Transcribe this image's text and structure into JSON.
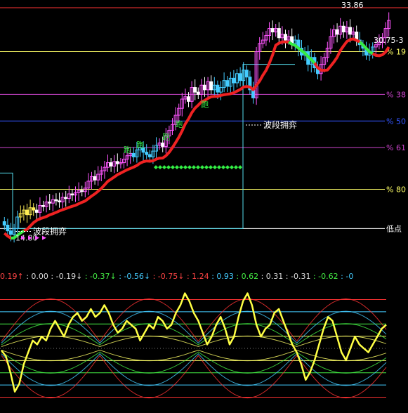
{
  "chart_data": [
    {
      "type": "candlestick",
      "panel": "price",
      "ylim": [
        13.5,
        35.0
      ],
      "price_labels": [
        {
          "text": "33.86",
          "value": 34.95
        },
        {
          "text": "30.75-3",
          "value": 31.9
        },
        {
          "text": "14.80",
          "value": 14.8
        }
      ],
      "fib_levels": [
        {
          "text": "% 19",
          "value": 30.9,
          "color": "#ffff66"
        },
        {
          "text": "% 38",
          "value": 27.2,
          "color": "#cc44cc"
        },
        {
          "text": "% 50",
          "value": 24.9,
          "color": "#3355ff"
        },
        {
          "text": "% 61",
          "value": 22.6,
          "color": "#cc44cc"
        },
        {
          "text": "% 80",
          "value": 19.0,
          "color": "#ffff66"
        },
        {
          "text": "低点",
          "value": 15.6,
          "color": "#ffffff"
        }
      ],
      "top_line": {
        "value": 34.7,
        "color": "#ff3333"
      },
      "annotations": [
        {
          "text": "波段拥弈",
          "value": 15.35,
          "color": "#ffffff"
        },
        {
          "text": "波段拥弈",
          "value": 24.55,
          "color": "#ffffff"
        }
      ],
      "marks": [
        "跑",
        "跑",
        "跑",
        "跑",
        "跑"
      ],
      "close": [
        15.9,
        15.4,
        15.1,
        15.6,
        16.6,
        16.9,
        17.2,
        16.8,
        17.4,
        17.2,
        17.0,
        17.6,
        17.5,
        17.9,
        17.8,
        18.1,
        18.0,
        17.9,
        18.3,
        18.2,
        18.6,
        18.5,
        18.7,
        18.9,
        18.8,
        19.1,
        19.7,
        20.1,
        19.8,
        20.3,
        20.6,
        20.9,
        21.3,
        21.0,
        21.4,
        21.2,
        21.3,
        21.6,
        21.9,
        22.1,
        21.8,
        22.4,
        22.6,
        22.2,
        22.0,
        21.8,
        22.3,
        22.8,
        23.0,
        22.7,
        23.6,
        24.1,
        24.6,
        25.4,
        26.0,
        26.8,
        27.0,
        26.6,
        27.8,
        27.4,
        27.2,
        28.0,
        27.6,
        28.3,
        27.6,
        28.0,
        27.4,
        27.8,
        28.4,
        27.9,
        28.6,
        28.2,
        29.0,
        28.4,
        29.3,
        28.7,
        27.6,
        26.9,
        30.9,
        31.6,
        31.9,
        32.3,
        32.9,
        32.6,
        32.9,
        32.1,
        32.4,
        31.9,
        32.2,
        31.6,
        31.9,
        31.2,
        30.6,
        30.9,
        29.8,
        30.4,
        29.5,
        29.0,
        29.8,
        30.4,
        31.2,
        32.2,
        32.8,
        32.4,
        33.1,
        32.6,
        33.0,
        32.4,
        32.6,
        31.9,
        31.5,
        31.2,
        30.6,
        30.9,
        31.3,
        31.5,
        31.7,
        32.1,
        32.9,
        33.6
      ]
    },
    {
      "type": "line",
      "panel": "oscillator",
      "ylim": [
        -1.5,
        1.5
      ],
      "values_bar": [
        {
          "text": "0.19↑",
          "color": "#ff4444"
        },
        {
          "text": ": 0.00",
          "color": "#dddddd"
        },
        {
          "text": ": -0.19↓",
          "color": "#dddddd"
        },
        {
          "text": ": -0.37↓",
          "color": "#44ee44"
        },
        {
          "text": ": -0.56↓",
          "color": "#44ccff"
        },
        {
          "text": ": -0.75↓",
          "color": "#ff4444"
        },
        {
          "text": ": 1.24",
          "color": "#ff4444"
        },
        {
          "text": ": 0.93",
          "color": "#44ccff"
        },
        {
          "text": ": 0.62",
          "color": "#44ee44"
        },
        {
          "text": ": 0.31",
          "color": "#dddddd"
        },
        {
          "text": ": -0.31",
          "color": "#dddddd"
        },
        {
          "text": ": -0.62",
          "color": "#44ee44"
        },
        {
          "text": ": -0",
          "color": "#44ccff"
        }
      ],
      "levels": [
        1.24,
        0.93,
        0.62,
        0.31,
        0.0,
        -0.31,
        -0.62,
        -0.93,
        -1.24
      ],
      "series": [
        {
          "color": "#ffff44",
          "values": [
            -0.05,
            -0.2,
            -0.6,
            -1.1,
            -0.9,
            -0.4,
            -0.1,
            0.2,
            0.1,
            0.3,
            0.2,
            0.5,
            0.7,
            0.5,
            0.3,
            0.6,
            0.8,
            0.9,
            0.7,
            0.8,
            1.0,
            0.8,
            0.9,
            1.1,
            0.9,
            0.6,
            0.4,
            0.5,
            0.7,
            0.6,
            0.5,
            0.2,
            0.4,
            0.6,
            0.5,
            0.8,
            0.7,
            0.5,
            0.6,
            0.9,
            1.1,
            1.4,
            1.2,
            0.9,
            0.7,
            0.4,
            0.1,
            0.3,
            0.6,
            0.8,
            0.5,
            0.1,
            0.3,
            0.8,
            1.2,
            1.4,
            1.1,
            0.6,
            0.3,
            0.5,
            0.6,
            0.9,
            1.0,
            0.7,
            0.4,
            0.1,
            -0.1,
            -0.4,
            -0.8,
            -0.6,
            -0.3,
            0.1,
            0.5,
            0.8,
            0.7,
            0.3,
            -0.1,
            -0.3,
            0.0,
            0.3,
            0.1,
            0.0,
            -0.1,
            0.1,
            0.3,
            0.5,
            0.6
          ]
        }
      ]
    }
  ]
}
